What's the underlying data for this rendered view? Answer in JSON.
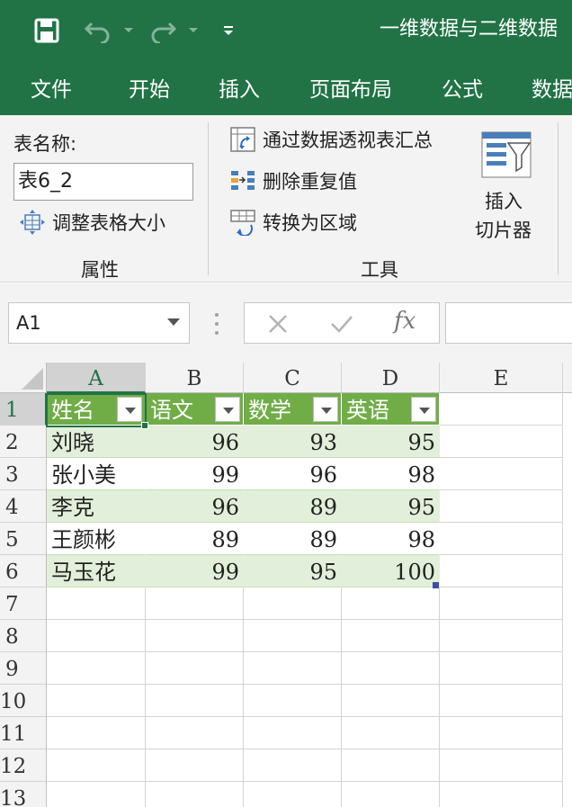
{
  "titlebar": {
    "title": "一维数据与二维数据",
    "icons": [
      "save-icon",
      "undo-icon",
      "redo-icon",
      "customize-qat-icon"
    ]
  },
  "tabs": [
    "文件",
    "开始",
    "插入",
    "页面布局",
    "公式",
    "数据"
  ],
  "ribbon": {
    "properties": {
      "table_name_label": "表名称:",
      "table_name_value": "表6_2",
      "resize_label": "调整表格大小",
      "group_title": "属性"
    },
    "tools": {
      "pivot_label": "通过数据透视表汇总",
      "remove_dup_label": "删除重复值",
      "convert_label": "转换为区域",
      "group_title": "工具"
    },
    "slicer": {
      "line1": "插入",
      "line2": "切片器"
    }
  },
  "formula_bar": {
    "name_box": "A1",
    "fx": "fx",
    "value": ""
  },
  "sheet": {
    "columns": [
      "A",
      "B",
      "C",
      "D",
      "E"
    ],
    "rows": [
      "1",
      "2",
      "3",
      "4",
      "5",
      "6",
      "7",
      "8",
      "9",
      "10",
      "11",
      "12",
      "13"
    ],
    "headers": [
      "姓名",
      "语文",
      "数学",
      "英语"
    ],
    "data": [
      [
        "刘晓",
        "96",
        "93",
        "95"
      ],
      [
        "张小美",
        "99",
        "96",
        "98"
      ],
      [
        "李克",
        "96",
        "89",
        "95"
      ],
      [
        "王颜彬",
        "89",
        "89",
        "98"
      ],
      [
        "马玉花",
        "99",
        "95",
        "100"
      ]
    ],
    "colors": {
      "header_fill": "#70ad47",
      "band_fill": "#e2efda",
      "accent": "#217346"
    }
  }
}
